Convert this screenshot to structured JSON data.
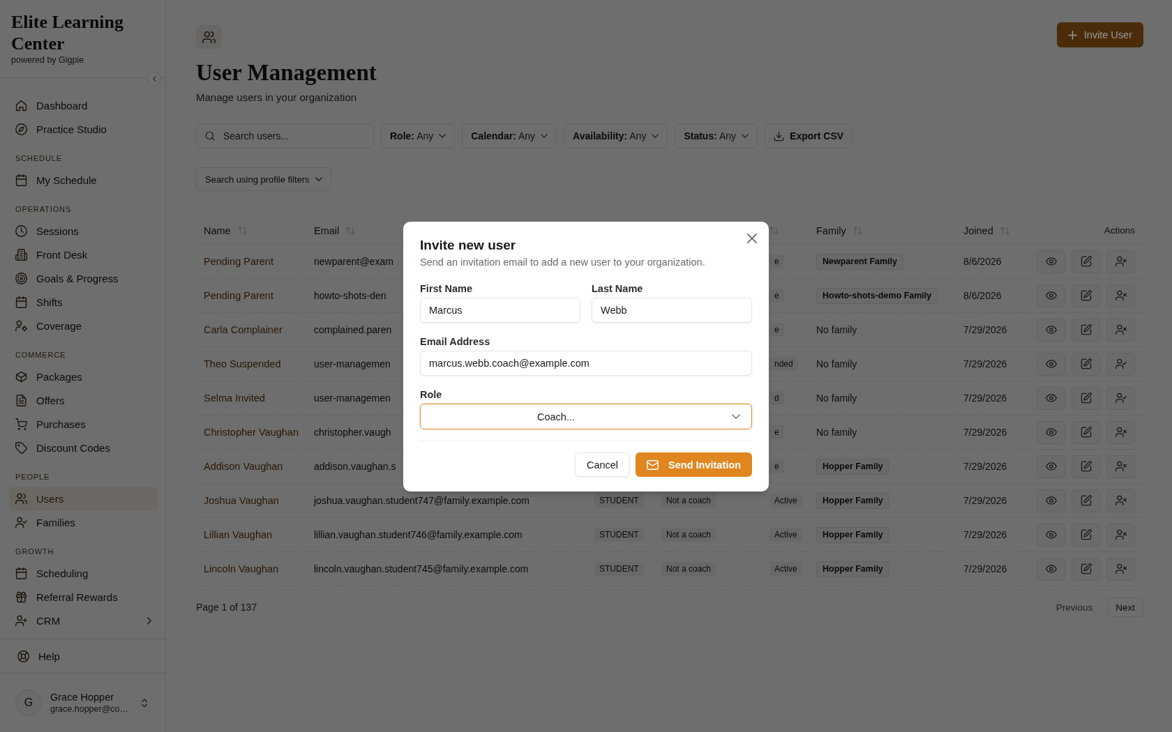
{
  "sidebar": {
    "brand": {
      "name": "Elite Learning Center",
      "tagline": "powered by Gigpie"
    },
    "sections": [
      {
        "items": [
          {
            "label": "Dashboard",
            "kind": "link",
            "selected": false
          },
          {
            "label": "Practice Studio",
            "kind": "link",
            "selected": false
          }
        ]
      },
      {
        "title": "SCHEDULE",
        "items": [
          {
            "label": "My Schedule",
            "kind": "link",
            "selected": false
          }
        ]
      },
      {
        "title": "OPERATIONS",
        "items": [
          {
            "label": "Sessions",
            "kind": "link",
            "selected": false
          },
          {
            "label": "Front Desk",
            "kind": "link",
            "selected": false
          },
          {
            "label": "Goals & Progress",
            "kind": "link",
            "selected": false
          },
          {
            "label": "Shifts",
            "kind": "link",
            "selected": false
          },
          {
            "label": "Coverage",
            "kind": "link",
            "selected": false
          }
        ]
      },
      {
        "title": "COMMERCE",
        "items": [
          {
            "label": "Packages",
            "kind": "link",
            "selected": false
          },
          {
            "label": "Offers",
            "kind": "link",
            "selected": false
          },
          {
            "label": "Purchases",
            "kind": "link",
            "selected": false
          },
          {
            "label": "Discount Codes",
            "kind": "link",
            "selected": false
          }
        ]
      },
      {
        "title": "PEOPLE",
        "items": [
          {
            "label": "Users",
            "kind": "link",
            "selected": true
          },
          {
            "label": "Families",
            "kind": "link",
            "selected": false
          }
        ]
      },
      {
        "title": "GROWTH",
        "items": [
          {
            "label": "Scheduling",
            "kind": "link",
            "selected": false
          },
          {
            "label": "Referral Rewards",
            "kind": "link",
            "selected": false
          },
          {
            "label": "CRM",
            "kind": "group",
            "selected": false
          }
        ]
      }
    ],
    "help": {
      "label": "Help"
    },
    "user": {
      "initial": "G",
      "name": "Grace Hopper",
      "email": "grace.hopper@co…"
    }
  },
  "header": {
    "title": "User Management",
    "subtitle": "Manage users in your organization",
    "invite_button": {
      "label": "Invite User"
    }
  },
  "toolbar": {
    "search": {
      "placeholder": "Search users..."
    },
    "filters": [
      {
        "label": "Role:",
        "value": "Any"
      },
      {
        "label": "Calendar:",
        "value": "Any"
      },
      {
        "label": "Availability:",
        "value": "Any"
      },
      {
        "label": "Status:",
        "value": "Any"
      }
    ],
    "export_button": {
      "label": "Export CSV"
    },
    "profile_filters": {
      "label": "Search using profile filters"
    }
  },
  "table": {
    "columns": {
      "name": {
        "label": "Name",
        "sortable": true
      },
      "email": {
        "label": "Email",
        "sortable": true
      },
      "status": {
        "sortable": true
      },
      "family": {
        "label": "Family",
        "sortable": true
      },
      "joined": {
        "label": "Joined",
        "sortable": true
      },
      "actions": {
        "label": "Actions",
        "sortable": false
      }
    },
    "rows": [
      {
        "name": "Pending Parent",
        "email": "newparent@exam",
        "status": "e",
        "family": {
          "label": "Newparent Family",
          "kind": "badge"
        },
        "joined": "8/6/2026",
        "actions": [
          {
            "kind": "view"
          },
          {
            "kind": "edit"
          },
          {
            "kind": "deactivate"
          }
        ]
      },
      {
        "name": "Pending Parent",
        "email": "howto-shots-den",
        "status": "e",
        "family": {
          "label": "Howto-shots-demo Family",
          "kind": "badge"
        },
        "joined": "8/6/2026",
        "actions": [
          {
            "kind": "view"
          },
          {
            "kind": "edit"
          },
          {
            "kind": "deactivate"
          }
        ]
      },
      {
        "name": "Carla Complainer",
        "email": "complained.paren",
        "status": "e",
        "family": {
          "label": "No family",
          "kind": "text"
        },
        "joined": "7/29/2026",
        "actions": [
          {
            "kind": "view"
          },
          {
            "kind": "edit"
          },
          {
            "kind": "deactivate"
          }
        ]
      },
      {
        "name": "Theo Suspended",
        "email": "user-managemen",
        "status": "nded",
        "family": {
          "label": "No family",
          "kind": "text"
        },
        "joined": "7/29/2026",
        "actions": [
          {
            "kind": "view"
          },
          {
            "kind": "edit"
          },
          {
            "kind": "activate"
          }
        ]
      },
      {
        "name": "Selma Invited",
        "email": "user-managemen",
        "status": "d",
        "family": {
          "label": "No family",
          "kind": "text"
        },
        "joined": "7/29/2026",
        "actions": [
          {
            "kind": "view"
          },
          {
            "kind": "edit"
          },
          {
            "kind": "activate"
          }
        ]
      },
      {
        "name": "Christopher Vaughan",
        "email": "christopher.vaugh",
        "status": "e",
        "family": {
          "label": "No family",
          "kind": "text"
        },
        "joined": "7/29/2026",
        "actions": [
          {
            "kind": "view"
          },
          {
            "kind": "edit"
          },
          {
            "kind": "deactivate"
          }
        ]
      },
      {
        "name": "Addison Vaughan",
        "email": "addison.vaughan.s",
        "status": "e",
        "family": {
          "label": "Hopper Family",
          "kind": "badge"
        },
        "joined": "7/29/2026",
        "actions": [
          {
            "kind": "view"
          },
          {
            "kind": "edit"
          },
          {
            "kind": "deactivate"
          }
        ]
      },
      {
        "name": "Joshua Vaughan",
        "email": "joshua.vaughan.student747@family.example.com",
        "role": "STUDENT",
        "availability": "Not a coach",
        "status": "Active",
        "family": {
          "label": "Hopper Family",
          "kind": "badge"
        },
        "joined": "7/29/2026",
        "actions": [
          {
            "kind": "view"
          },
          {
            "kind": "edit"
          },
          {
            "kind": "deactivate"
          }
        ]
      },
      {
        "name": "Lillian Vaughan",
        "email": "lillian.vaughan.student746@family.example.com",
        "role": "STUDENT",
        "availability": "Not a coach",
        "status": "Active",
        "family": {
          "label": "Hopper Family",
          "kind": "badge"
        },
        "joined": "7/29/2026",
        "actions": [
          {
            "kind": "view"
          },
          {
            "kind": "edit"
          },
          {
            "kind": "deactivate"
          }
        ]
      },
      {
        "name": "Lincoln Vaughan",
        "email": "lincoln.vaughan.student745@family.example.com",
        "role": "STUDENT",
        "availability": "Not a coach",
        "status": "Active",
        "family": {
          "label": "Hopper Family",
          "kind": "badge"
        },
        "joined": "7/29/2026",
        "actions": [
          {
            "kind": "view"
          },
          {
            "kind": "edit"
          },
          {
            "kind": "deactivate"
          }
        ]
      }
    ]
  },
  "pagination": {
    "summary": "Page 1 of 137",
    "previous": {
      "label": "Previous",
      "disabled": true
    },
    "next": {
      "label": "Next",
      "disabled": false
    }
  },
  "modal": {
    "title": "Invite new user",
    "description": "Send an invitation email to add a new user to your organization.",
    "field_rows": [
      [
        {
          "label": "First Name",
          "kind": "text",
          "value": "Marcus",
          "focused": false
        },
        {
          "label": "Last Name",
          "kind": "text",
          "value": "Webb",
          "focused": false
        }
      ],
      [
        {
          "label": "Email Address",
          "kind": "email",
          "value": "marcus.webb.coach@example.com",
          "focused": false
        }
      ],
      [
        {
          "label": "Role",
          "kind": "select",
          "value": "Coach...",
          "focused": true
        }
      ]
    ],
    "buttons": [
      {
        "label": "Cancel",
        "kind": "secondary"
      },
      {
        "label": "Send Invitation",
        "kind": "primary"
      }
    ]
  }
}
